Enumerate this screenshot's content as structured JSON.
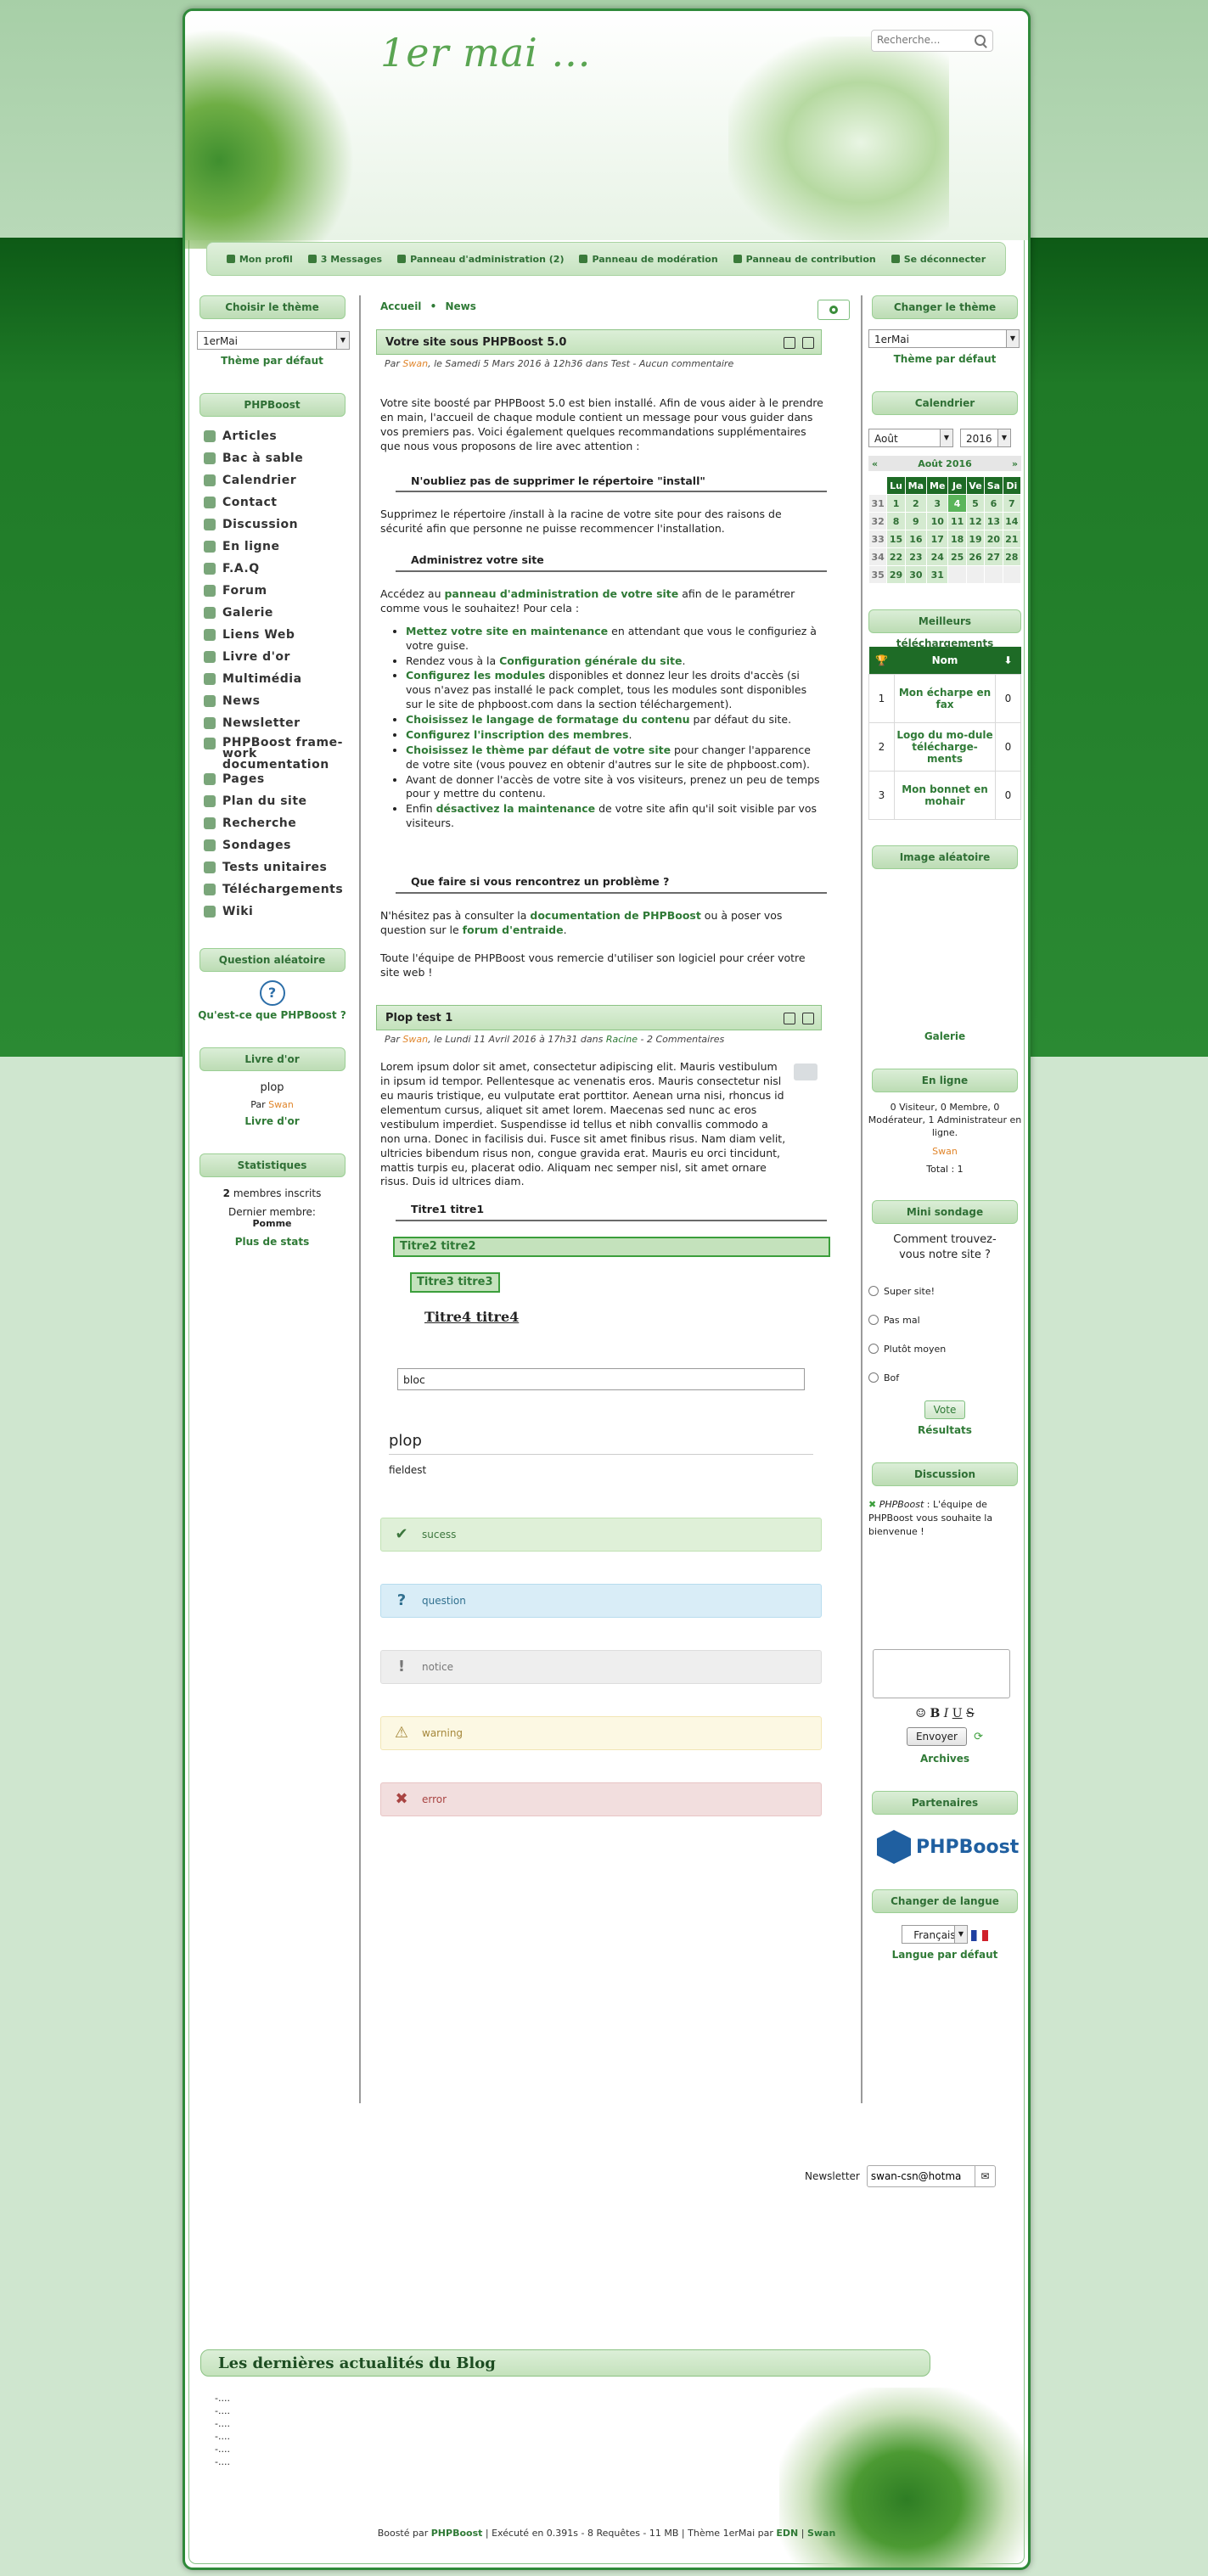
{
  "header": {
    "site_title": "1er mai ...",
    "search_placeholder": "Recherche..."
  },
  "userbar": [
    {
      "label": "Mon profil"
    },
    {
      "label": "3 Messages"
    },
    {
      "label": "Panneau d'administration (2)"
    },
    {
      "label": "Panneau de modération"
    },
    {
      "label": "Panneau de contribution"
    },
    {
      "label": "Se déconnecter"
    }
  ],
  "left": {
    "theme_title": "Choisir le thème",
    "theme_value": "1erMai",
    "theme_default": "Thème par défaut",
    "phpboost_title": "PHPBoost",
    "menu": [
      "Articles",
      "Bac à sable",
      "Calendrier",
      "Contact",
      "Discussion",
      "En ligne",
      "F.A.Q",
      "Forum",
      "Galerie",
      "Liens Web",
      "Livre d'or",
      "Multimédia",
      "News",
      "Newsletter",
      "PHPBoost frame-work documentation",
      "Pages",
      "Plan du site",
      "Recherche",
      "Sondages",
      "Tests unitaires",
      "Téléchargements",
      "Wiki"
    ],
    "question_title": "Question aléatoire",
    "question_link": "Qu'est-ce que PHPBoost ?",
    "guestbook_title": "Livre d'or",
    "guestbook_msg": "plop",
    "guestbook_by": "Par",
    "guestbook_author": "Swan",
    "guestbook_link": "Livre d'or",
    "stats_title": "Statistiques",
    "stats_members_count": "2",
    "stats_members_label": "membres inscrits",
    "stats_last_label": "Dernier membre:",
    "stats_last_member": "Pomme",
    "stats_more": "Plus de stats"
  },
  "main": {
    "breadcrumb": [
      "Accueil",
      "News"
    ],
    "article1": {
      "title": "Votre site sous PHPBoost 5.0",
      "by": "Par",
      "author": "Swan",
      "meta": ", le Samedi 5 Mars 2016 à 12h36 dans Test - Aucun commentaire",
      "p1": "Votre site boosté par PHPBoost 5.0 est bien installé. Afin de vous aider à le prendre en main, l'accueil de chaque module contient un message pour vous guider dans vos premiers pas. Voici également quelques recommandations supplémentaires que nous vous proposons de lire avec attention :",
      "h1": "N'oubliez pas de supprimer le répertoire \"install\"",
      "p2": "Supprimez le répertoire /install à la racine de votre site pour des raisons de sécurité afin que personne ne puisse recommencer l'installation.",
      "h2": "Administrez votre site",
      "p3_before": "Accédez au ",
      "p3_link": "panneau d'administration de votre site",
      "p3_after": " afin de le paramétrer comme vous le souhaitez! Pour cela :",
      "list": [
        {
          "link": "Mettez votre site en maintenance",
          "text": " en attendant que vous le configuriez à votre guise."
        },
        {
          "pre": "Rendez vous à la ",
          "link": "Configuration générale du site",
          "text": "."
        },
        {
          "link": "Configurez les modules",
          "text": " disponibles et donnez leur les droits d'accès (si vous n'avez pas installé le pack complet, tous les modules sont disponibles sur le site de phpboost.com dans la section téléchargement)."
        },
        {
          "link": "Choisissez le langage de formatage du contenu",
          "text": " par défaut du site."
        },
        {
          "link": "Configurez l'inscription des membres",
          "text": "."
        },
        {
          "link": "Choisissez le thème par défaut de votre site",
          "text": " pour changer l'apparence de votre site (vous pouvez en obtenir d'autres sur le site de phpboost.com)."
        },
        {
          "text": "Avant de donner l'accès de votre site à vos visiteurs, prenez un peu de temps pour y mettre du contenu."
        },
        {
          "pre": "Enfin ",
          "link": "désactivez la maintenance",
          "text": " de votre site afin qu'il soit visible par vos visiteurs."
        }
      ],
      "h3": "Que faire si vous rencontrez un problème ?",
      "p4_before": "N'hésitez pas à consulter la ",
      "p4_link1": "documentation de PHPBoost",
      "p4_mid": " ou à poser vos question sur le ",
      "p4_link2": "forum d'entraide",
      "p4_after": ".",
      "p5": "Toute l'équipe de PHPBoost vous remercie d'utiliser son logiciel pour créer votre site web !"
    },
    "article2": {
      "title": "Plop test 1",
      "by": "Par",
      "author": "Swan",
      "meta_a": ", le Lundi 11 Avril 2016 à 17h31 dans ",
      "category": "Racine",
      "meta_b": " - 2 Commentaires",
      "lorem": "Lorem ipsum dolor sit amet, consectetur adipiscing elit. Mauris vestibulum in ipsum id tempor. Pellentesque ac venenatis eros. Mauris consectetur nisl eu mauris tristique, eu vulputate erat porttitor. Aenean urna nisi, rhoncus id elementum cursus, aliquet sit amet lorem. Maecenas sed nunc ac eros vestibulum imperdiet. Suspendisse id tellus et nibh convallis commodo a non urna. Donec in facilisis dui. Fusce sit amet finibus risus. Nam diam velit, ultricies bibendum risus non, congue gravida erat. Mauris eu orci tincidunt, mattis turpis eu, placerat odio. Aliquam nec semper nisl, sit amet ornare risus. Duis id ultrices diam.",
      "t1": "Titre1 titre1",
      "t2": "Titre2 titre2",
      "t3": "Titre3 titre3",
      "t4": "Titre4 titre4",
      "bloc": "bloc",
      "fieldset_legend": "plop",
      "fieldset_text": "fieldest",
      "messages": [
        {
          "type": "success",
          "label": "sucess",
          "icon": "✔"
        },
        {
          "type": "question",
          "label": "question",
          "icon": "?"
        },
        {
          "type": "notice",
          "label": "notice",
          "icon": "!"
        },
        {
          "type": "warning",
          "label": "warning",
          "icon": "⚠"
        },
        {
          "type": "error",
          "label": "error",
          "icon": "✖"
        }
      ]
    }
  },
  "right": {
    "theme_title": "Changer le thème",
    "theme_value": "1erMai",
    "theme_default": "Thème par défaut",
    "calendar_title": "Calendrier",
    "month_select": "Août",
    "year_select": "2016",
    "month_label": "Août 2016",
    "days": [
      "Lu",
      "Ma",
      "Me",
      "Je",
      "Ve",
      "Sa",
      "Di"
    ],
    "weeks": [
      {
        "wk": "31",
        "d": [
          "1",
          "2",
          "3",
          "4",
          "5",
          "6",
          "7"
        ]
      },
      {
        "wk": "32",
        "d": [
          "8",
          "9",
          "10",
          "11",
          "12",
          "13",
          "14"
        ]
      },
      {
        "wk": "33",
        "d": [
          "15",
          "16",
          "17",
          "18",
          "19",
          "20",
          "21"
        ]
      },
      {
        "wk": "34",
        "d": [
          "22",
          "23",
          "24",
          "25",
          "26",
          "27",
          "28"
        ]
      },
      {
        "wk": "35",
        "d": [
          "29",
          "30",
          "31",
          "",
          "",
          "",
          ""
        ]
      }
    ],
    "downloads_title": "Meilleurs téléchargements",
    "downloads_col": "Nom",
    "downloads": [
      {
        "rank": "1",
        "name": "Mon écharpe en fax",
        "count": "0"
      },
      {
        "rank": "2",
        "name": "Logo du mo-dule télécharge-ments",
        "count": "0"
      },
      {
        "rank": "3",
        "name": "Mon bonnet en mohair",
        "count": "0"
      }
    ],
    "random_image_title": "Image aléatoire",
    "gallery_link": "Galerie",
    "online_title": "En ligne",
    "online_text": "0 Visiteur, 0 Membre, 0 Modérateur, 1 Administrateur en ligne.",
    "online_user": "Swan",
    "online_total": "Total : 1",
    "poll_title": "Mini sondage",
    "poll_question": "Comment trouvez-vous notre site ?",
    "poll_options": [
      "Super site!",
      "Pas mal",
      "Plutôt moyen",
      "Bof"
    ],
    "poll_vote": "Vote",
    "poll_results": "Résultats",
    "discussion_title": "Discussion",
    "discussion_author": "PHPBoost",
    "discussion_msg": " : L'équipe de PHPBoost vous souhaite la bienvenue !",
    "send_button": "Envoyer",
    "archives_link": "Archives",
    "partners_title": "Partenaires",
    "partner_logo": "PHPBoost",
    "lang_title": "Changer de langue",
    "lang_value": "Français",
    "lang_default": "Langue par défaut"
  },
  "newsletter": {
    "label": "Newsletter",
    "value": "swan-csn@hotma"
  },
  "footer": {
    "news_title": "Les dernières actualités du Blog",
    "news_items": [
      "-....",
      "-....",
      "-....",
      "-....",
      "-....",
      "-...."
    ],
    "credit_before": "Boosté par ",
    "credit_link": "PHPBoost",
    "credit_mid": " | Exécuté en 0.391s - 8 Requêtes - 11 MB | Thème 1erMai par ",
    "credit_edn": "EDN",
    "credit_sep": " | ",
    "credit_swan": "Swan"
  }
}
